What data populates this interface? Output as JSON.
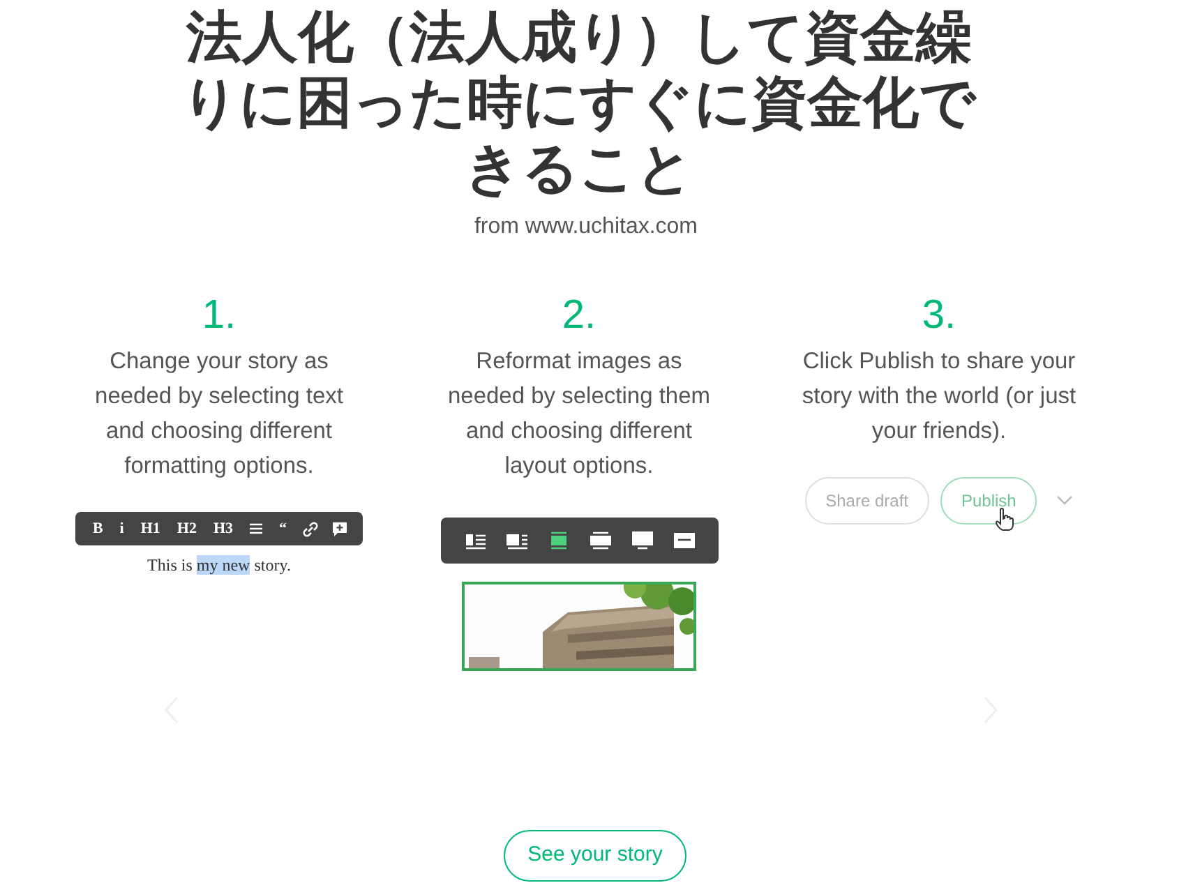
{
  "title": "法人化（法人成り）して資金繰りに困った時にすぐに資金化できること",
  "source": "from www.uchitax.com",
  "steps": [
    {
      "number": "1.",
      "text": "Change your story as needed by selecting text and choosing different formatting options."
    },
    {
      "number": "2.",
      "text": "Reformat images as needed by selecting them and choosing different layout options."
    },
    {
      "number": "3.",
      "text": "Click Publish to share your story with the world (or just your friends)."
    }
  ],
  "text_toolbar": [
    {
      "kind": "text",
      "label": "B"
    },
    {
      "kind": "text",
      "label": "i"
    },
    {
      "kind": "text",
      "label": "H1"
    },
    {
      "kind": "text",
      "label": "H2"
    },
    {
      "kind": "text",
      "label": "H3"
    },
    {
      "kind": "strike"
    },
    {
      "kind": "text",
      "label": "“"
    },
    {
      "kind": "link"
    },
    {
      "kind": "comment"
    }
  ],
  "sample_text": [
    {
      "text": "This is",
      "selected": false
    },
    {
      "text": "my new",
      "selected": true
    },
    {
      "text": "story.",
      "selected": false
    }
  ],
  "image_toolbar": [
    {
      "kind": "inset-left",
      "selected": false
    },
    {
      "kind": "outset-left",
      "selected": false
    },
    {
      "kind": "column",
      "selected": true
    },
    {
      "kind": "wide",
      "selected": false
    },
    {
      "kind": "full",
      "selected": false
    },
    {
      "kind": "grid",
      "selected": false
    }
  ],
  "image": {
    "selected": true
  },
  "publish_buttons": [
    {
      "label": "Share draft",
      "kind": "secondary"
    },
    {
      "label": "Publish",
      "kind": "primary"
    }
  ],
  "cta": "See your story"
}
